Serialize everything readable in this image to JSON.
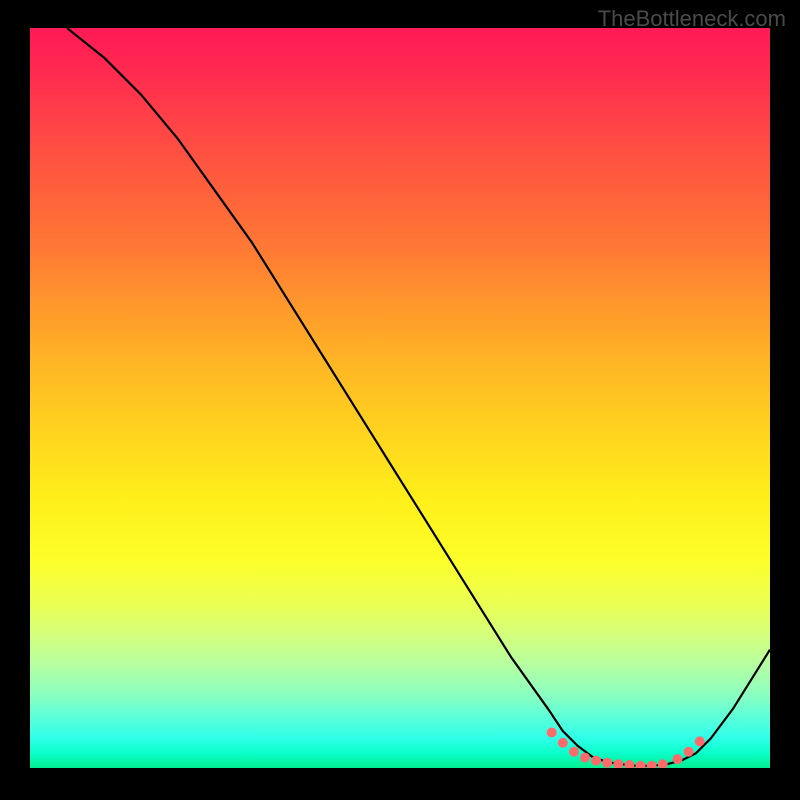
{
  "watermark": "TheBottleneck.com",
  "chart_data": {
    "type": "line",
    "title": "",
    "xlabel": "",
    "ylabel": "",
    "xlim": [
      0,
      100
    ],
    "ylim": [
      0,
      100
    ],
    "series": [
      {
        "name": "curve",
        "x": [
          5,
          10,
          15,
          20,
          25,
          30,
          35,
          40,
          45,
          50,
          55,
          60,
          65,
          70,
          72,
          74,
          76,
          78,
          80,
          82,
          84,
          86,
          88,
          90,
          92,
          95,
          100
        ],
        "y": [
          100,
          96,
          91,
          85,
          78,
          71,
          63,
          55,
          47,
          39,
          31,
          23,
          15,
          8,
          5,
          3,
          1.5,
          0.8,
          0.5,
          0.3,
          0.3,
          0.5,
          1,
          2,
          4,
          8,
          16
        ]
      }
    ],
    "markers": {
      "name": "highlight-dots",
      "x": [
        70.5,
        72,
        73.5,
        75,
        76.5,
        78,
        79.5,
        81,
        82.5,
        84,
        85.5,
        87.5,
        89,
        90.5
      ],
      "y": [
        4.8,
        3.4,
        2.2,
        1.4,
        1.0,
        0.7,
        0.5,
        0.4,
        0.3,
        0.3,
        0.5,
        1.2,
        2.2,
        3.6
      ]
    },
    "background_gradient": {
      "top": "#ff1a55",
      "middle": "#fff01a",
      "bottom": "#00ee8f"
    }
  }
}
